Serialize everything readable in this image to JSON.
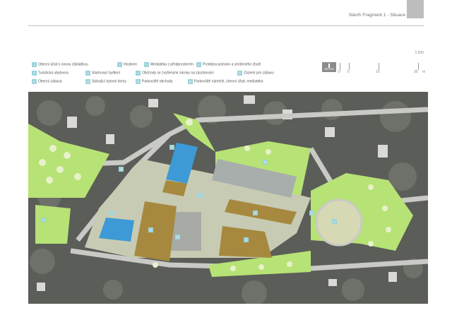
{
  "header": {
    "title": "Návrh Fragment 1 - Situace"
  },
  "legend": {
    "items": [
      {
        "num": "1",
        "label": "Obecní úřad s novou základbou"
      },
      {
        "num": "2",
        "label": "Hostinec"
      },
      {
        "num": "3",
        "label": "Mediatéka s předprostorem"
      },
      {
        "num": "4",
        "label": "Prodejna potravin a smíšeného zboží"
      },
      {
        "num": "5",
        "label": "Turistická ubytovna"
      },
      {
        "num": "6",
        "label": "Startovací bydlení"
      },
      {
        "num": "7",
        "label": "Obchody se zvýšenými nároky na zásobování"
      },
      {
        "num": "8",
        "label": "Zázemí pro zábavu"
      },
      {
        "num": "9",
        "label": "Obecní zábava"
      },
      {
        "num": "10",
        "label": "Stávající bytové domy"
      },
      {
        "num": "11",
        "label": "Parkoviště obchody"
      },
      {
        "num": "12",
        "label": "Parkoviště náměstí, obecní úřad, mediatéka"
      }
    ]
  },
  "scale": {
    "ratio": "1:500",
    "north_label": "SEVER",
    "ticks": [
      "0",
      "5",
      "15",
      "30",
      "m"
    ]
  },
  "map": {
    "colors": {
      "aerial": "#5b5d58",
      "road": "#c9cac6",
      "green": "#b7e275",
      "building_brown": "#a6893f",
      "building_blue": "#3d9ad6",
      "building_gray": "#a8aeab",
      "plaza": "#c8cbb3",
      "label": "#9ed3db"
    },
    "labels": [
      "1",
      "2",
      "3",
      "4",
      "5",
      "6",
      "7",
      "8",
      "9",
      "10",
      "11",
      "12"
    ]
  }
}
